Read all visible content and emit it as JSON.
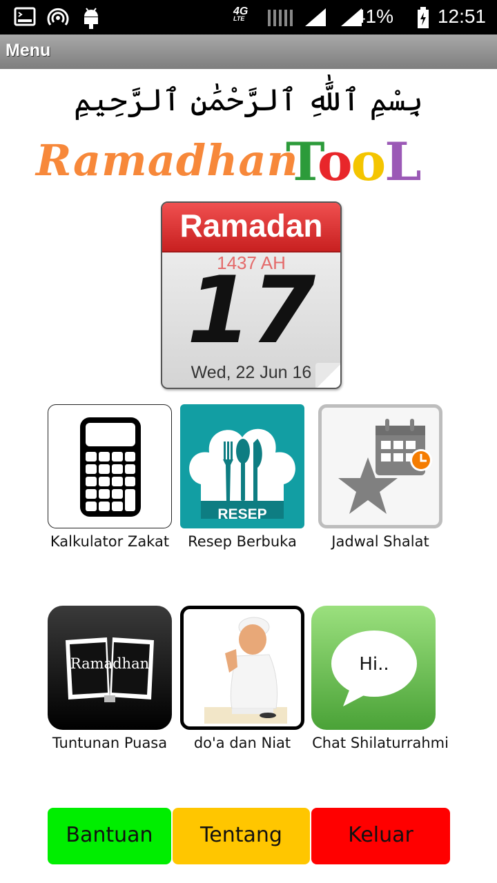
{
  "status_bar": {
    "network": "4G LTE",
    "battery": "41%",
    "time": "12:51",
    "icons": [
      "terminal-icon",
      "hotspot-icon",
      "android-icon",
      "signal-icon",
      "battery-icon"
    ]
  },
  "action_bar": {
    "title": "Menu"
  },
  "header": {
    "bismillah": "بِسْمِ ٱللَّٰهِ ٱلرَّحْمَٰنِ ٱلرَّحِيمِ",
    "logo_left": "Ramadhan",
    "logo_right_letters": [
      "T",
      "o",
      "o",
      "L"
    ],
    "logo_right_colors": [
      "#2c9b3a",
      "#e8262a",
      "#f4c500",
      "#9b59b6"
    ]
  },
  "calendar": {
    "month": "Ramadan",
    "year": "1437 AH",
    "day": "17",
    "date": "Wed, 22 Jun 16"
  },
  "menu": {
    "zakat": {
      "label": "Kalkulator Zakat"
    },
    "resep": {
      "label": "Resep Berbuka",
      "badge": "RESEP"
    },
    "jadwal": {
      "label": "Jadwal Shalat"
    },
    "tuntunan": {
      "label": "Tuntunan Puasa",
      "book_text": "Ramadhan"
    },
    "doa": {
      "label": "do'a dan Niat"
    },
    "chat": {
      "label": "Chat Shilaturrahmi",
      "bubble_text": "Hi.."
    }
  },
  "buttons": {
    "bantuan": {
      "label": "Bantuan",
      "color": "#00ee00"
    },
    "tentang": {
      "label": "Tentang",
      "color": "#ffc600"
    },
    "keluar": {
      "label": "Keluar",
      "color": "#ff0000"
    }
  }
}
